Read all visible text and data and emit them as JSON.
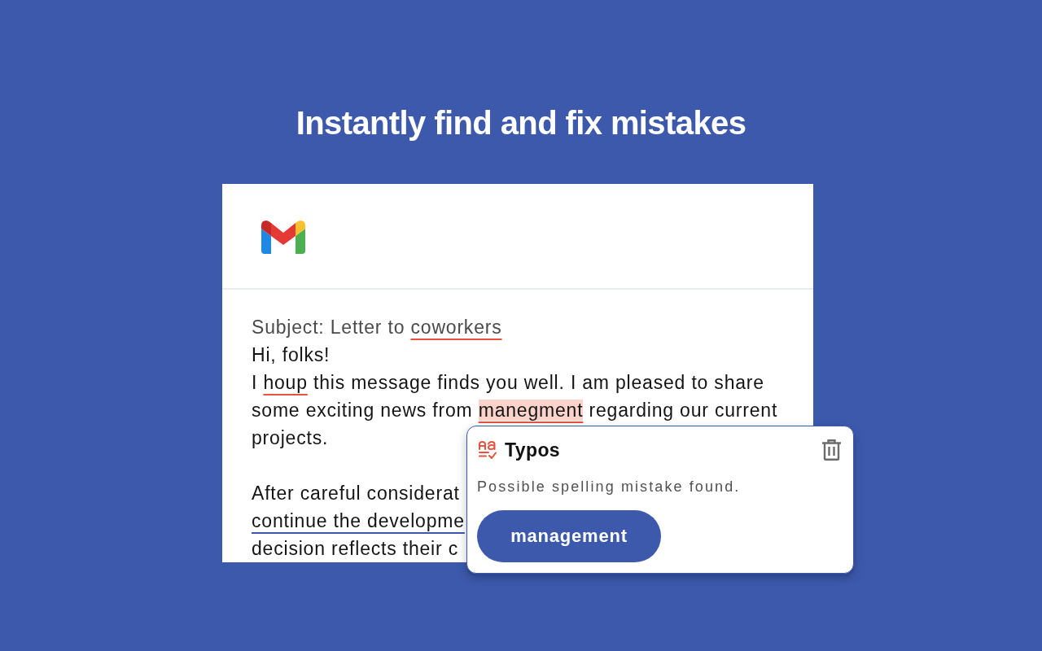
{
  "headline": "Instantly find and fix mistakes",
  "email": {
    "subject": {
      "segments": [
        {
          "text": "Subject: Letter to ",
          "kind": "plain",
          "selected": false
        },
        {
          "text": "coworkers",
          "kind": "spelling",
          "selected": false
        }
      ]
    },
    "paragraphs": [
      {
        "lines": [
          {
            "segments": [
              {
                "text": "Hi, folks!",
                "kind": "plain",
                "selected": false
              }
            ]
          },
          {
            "segments": [
              {
                "text": "I ",
                "kind": "plain",
                "selected": false
              },
              {
                "text": "houp",
                "kind": "spelling",
                "selected": false
              },
              {
                "text": " this message finds you well. I am pleased to share",
                "kind": "plain",
                "selected": false
              }
            ]
          },
          {
            "segments": [
              {
                "text": "some exciting news from ",
                "kind": "plain",
                "selected": false
              },
              {
                "text": "manegment",
                "kind": "spelling",
                "selected": true
              },
              {
                "text": " regarding our current",
                "kind": "plain",
                "selected": false
              }
            ]
          },
          {
            "segments": [
              {
                "text": "projects.",
                "kind": "plain",
                "selected": false
              }
            ]
          }
        ]
      },
      {
        "lines": [
          {
            "segments": [
              {
                "text": "After careful considerat",
                "kind": "plain",
                "selected": false
              }
            ]
          },
          {
            "segments": [
              {
                "text": "continue the developme",
                "kind": "style",
                "selected": false
              }
            ]
          },
          {
            "segments": [
              {
                "text": "decision reflects their c",
                "kind": "plain",
                "selected": false
              }
            ]
          }
        ]
      }
    ]
  },
  "popup": {
    "title": "Typos",
    "message": "Possible spelling mistake found.",
    "suggestion": "management"
  }
}
